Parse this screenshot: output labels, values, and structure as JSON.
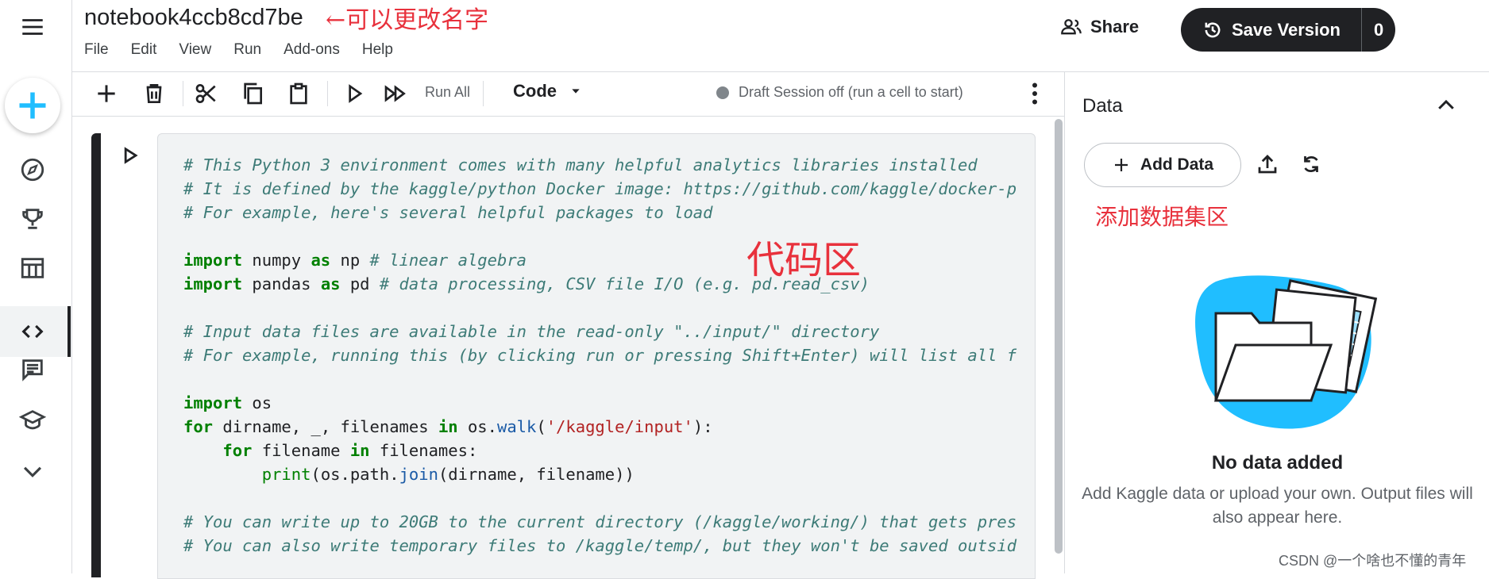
{
  "notebook": {
    "title": "notebook4ccb8cd7be",
    "title_annotation": "←可以更改名字",
    "menu": [
      "File",
      "Edit",
      "View",
      "Run",
      "Add-ons",
      "Help"
    ]
  },
  "header": {
    "share_label": "Share",
    "save_version_label": "Save Version",
    "version_count": "0"
  },
  "rail": {
    "icons": [
      "menu-icon",
      "create-icon",
      "compass-icon",
      "trophy-icon",
      "table-icon",
      "code-icon",
      "comment-icon",
      "school-icon",
      "chevron-down-icon"
    ],
    "active": "code-icon"
  },
  "toolbar": {
    "run_all_label": "Run All",
    "cell_type": "Code",
    "session_status": "Draft Session off (run a cell to start)"
  },
  "cell": {
    "code_annotation": "代码区",
    "lines": [
      "# This Python 3 environment comes with many helpful analytics libraries installed",
      "# It is defined by the kaggle/python Docker image: https://github.com/kaggle/docker-p",
      "# For example, here's several helpful packages to load",
      "",
      "import numpy as np # linear algebra",
      "import pandas as pd # data processing, CSV file I/O (e.g. pd.read_csv)",
      "",
      "# Input data files are available in the read-only \"../input/\" directory",
      "# For example, running this (by clicking run or pressing Shift+Enter) will list all f",
      "",
      "import os",
      "for dirname, _, filenames in os.walk('/kaggle/input'):",
      "    for filename in filenames:",
      "        print(os.path.join(dirname, filename))",
      "",
      "# You can write up to 20GB to the current directory (/kaggle/working/) that gets pres",
      "# You can also write temporary files to /kaggle/temp/, but they won't be saved outsid"
    ]
  },
  "panel": {
    "title": "Data",
    "add_data_label": "Add Data",
    "data_annotation": "添加数据集区",
    "empty_title": "No data added",
    "empty_desc": "Add Kaggle data or upload your own. Output files will also appear here."
  },
  "watermark": "CSDN @一个啥也不懂的青年",
  "colors": {
    "accent": "#20beff",
    "annotation": "#e8313c",
    "dark": "#202124"
  }
}
